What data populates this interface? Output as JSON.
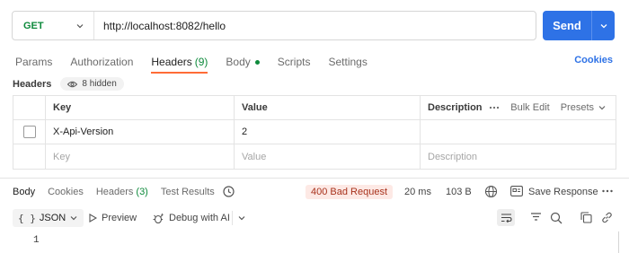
{
  "request": {
    "method": "GET",
    "url": "http://localhost:8082/hello",
    "send_label": "Send"
  },
  "request_tabs": [
    {
      "label": "Params"
    },
    {
      "label": "Authorization"
    },
    {
      "label": "Headers",
      "count": "(9)"
    },
    {
      "label": "Body"
    },
    {
      "label": "Scripts"
    },
    {
      "label": "Settings"
    }
  ],
  "cookies_label": "Cookies",
  "headers_section": {
    "label": "Headers",
    "hidden_label": "8 hidden"
  },
  "table": {
    "columns": [
      "Key",
      "Value",
      "Description"
    ],
    "bulk_edit": "Bulk Edit",
    "presets": "Presets",
    "rows": [
      {
        "key": "X-Api-Version",
        "value": "2",
        "description": ""
      }
    ],
    "placeholder": {
      "key": "Key",
      "value": "Value",
      "description": "Description"
    }
  },
  "response": {
    "tabs": [
      {
        "label": "Body"
      },
      {
        "label": "Cookies"
      },
      {
        "label": "Headers",
        "count": "(3)"
      },
      {
        "label": "Test Results"
      }
    ],
    "status": "400 Bad Request",
    "time": "20 ms",
    "size": "103 B",
    "save_label": "Save Response",
    "format": "JSON",
    "preview_label": "Preview",
    "debug_label": "Debug with AI",
    "line_number": "1"
  },
  "colors": {
    "accent": "#ff6c37",
    "send": "#2e72e6",
    "method_get": "#0e8a3c",
    "error_bg": "#fde9e5",
    "error_text": "#a8321c"
  }
}
